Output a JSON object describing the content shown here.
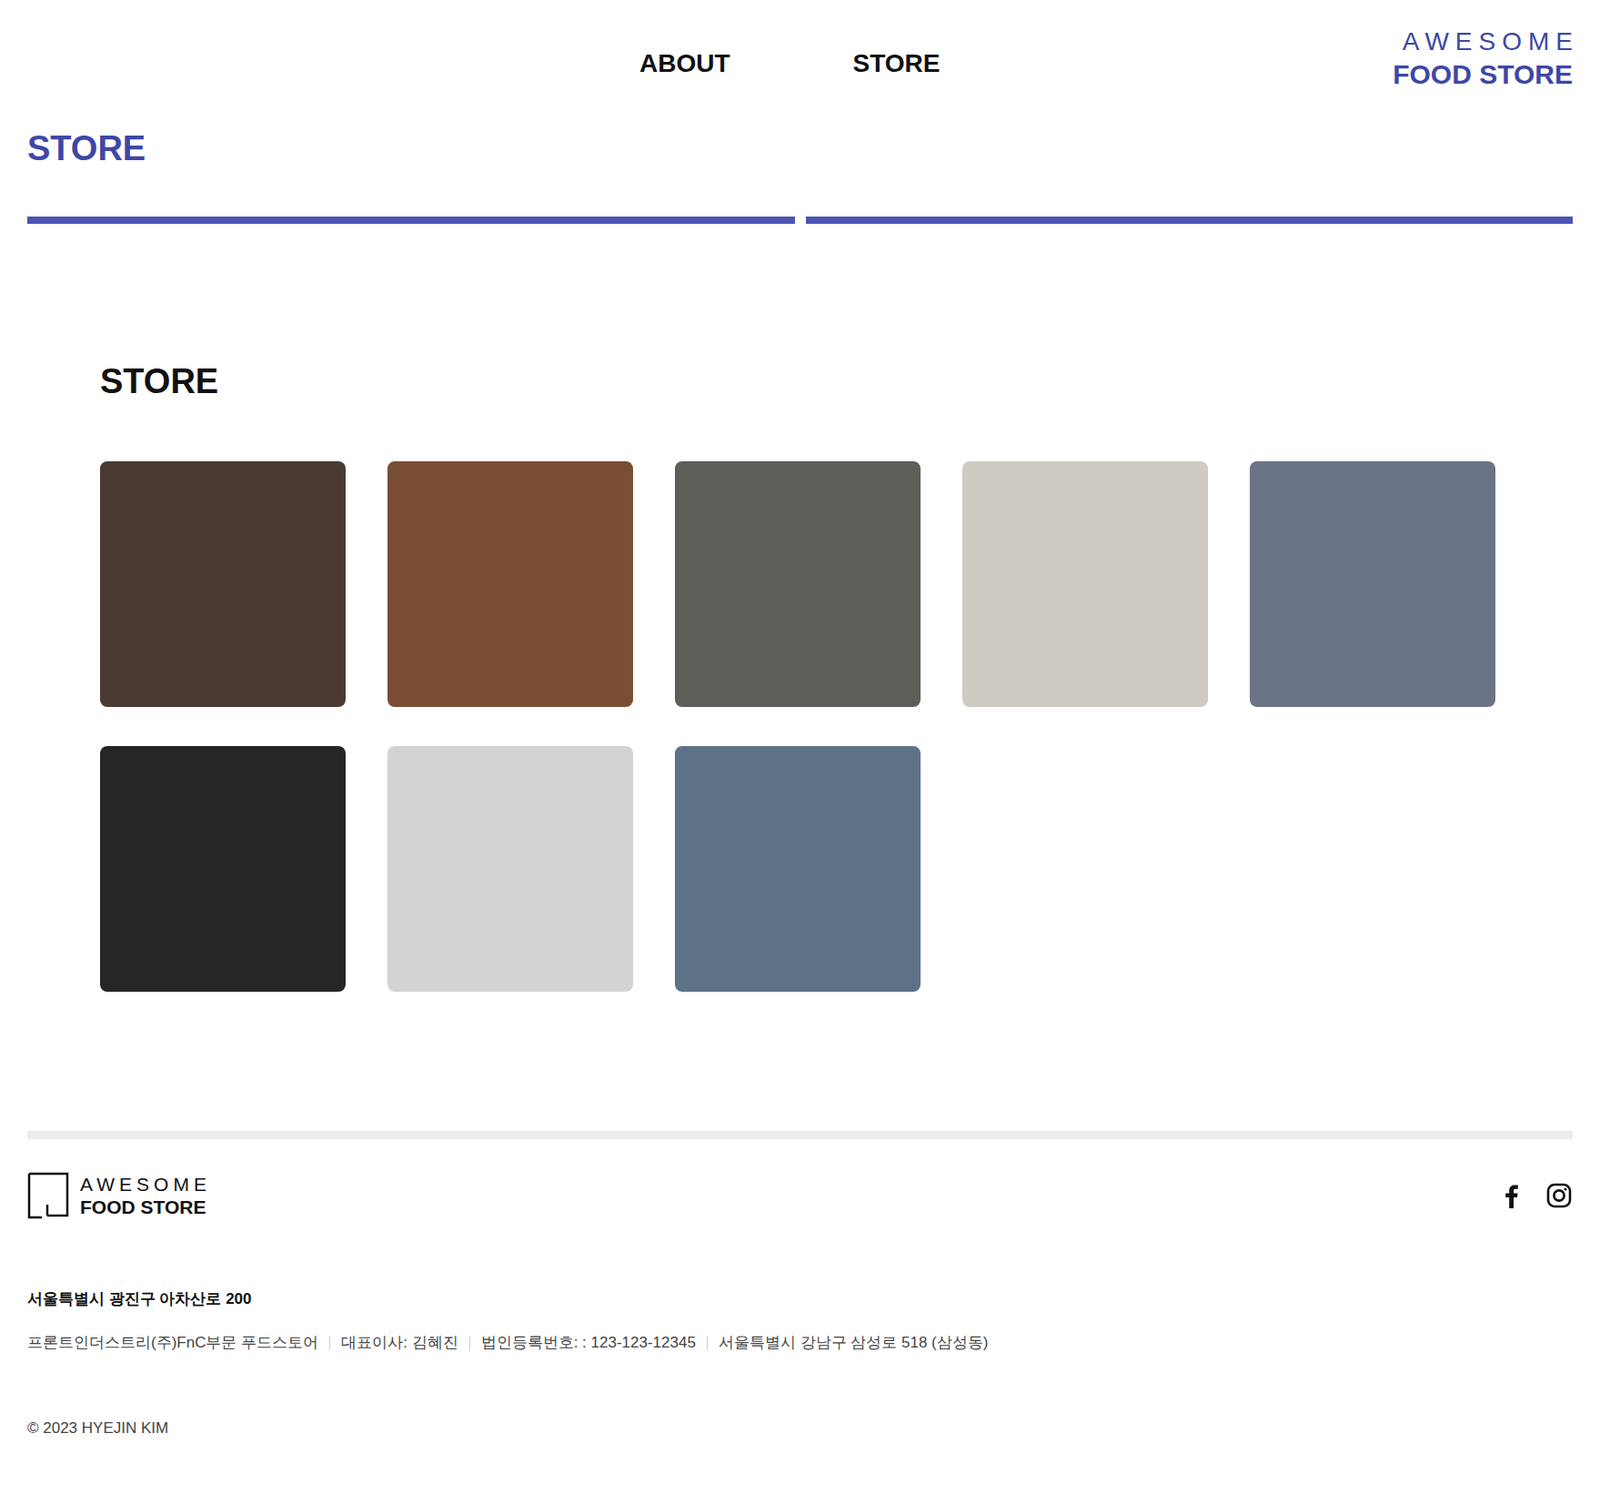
{
  "header": {
    "nav": [
      "ABOUT",
      "STORE"
    ],
    "logo": [
      "AWESOME",
      "FOOD STORE"
    ]
  },
  "page_title": "STORE",
  "store_section": {
    "title": "STORE",
    "stores": [
      {
        "color": "#4a3a32"
      },
      {
        "color": "#7a4e34"
      },
      {
        "color": "#5f5d5a"
      },
      {
        "color": "#cfcbc3"
      },
      {
        "color": "#6b7486"
      },
      {
        "color": "#262626"
      },
      {
        "color": "#d3d3d3"
      },
      {
        "color": "#5e7287"
      }
    ]
  },
  "footer": {
    "logo": [
      "AWESOME",
      "FOOD STORE"
    ],
    "address": "서울특별시 광진구 아차산로 200",
    "info": [
      "프론트인더스트리(주)FnC부문 푸드스토어",
      "대표이사: 김혜진",
      "법인등록번호: : 123-123-12345",
      "서울특별시 강남구 삼성로 518 (삼성동)"
    ],
    "copyright": "© 2023 HYEJIN KIM"
  }
}
